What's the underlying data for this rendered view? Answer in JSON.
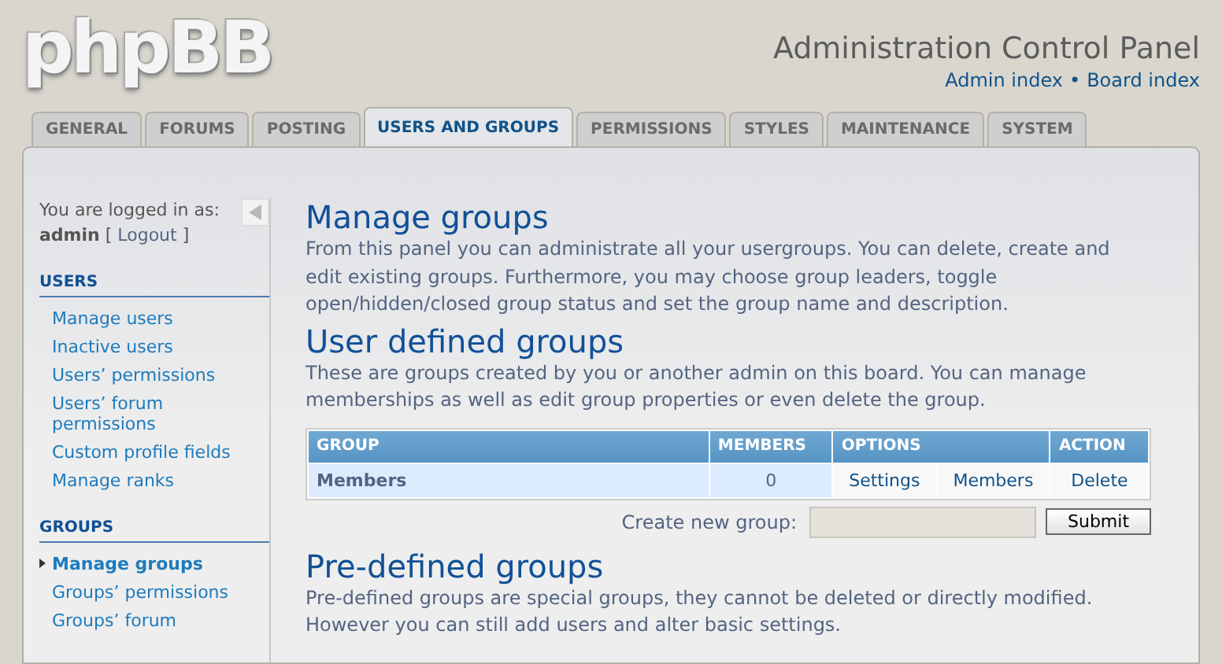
{
  "header": {
    "logo": "phpBB",
    "title": "Administration Control Panel",
    "links": [
      "Admin index",
      "Board index"
    ],
    "separator": "•"
  },
  "tabs": [
    {
      "label": "GENERAL",
      "selected": false
    },
    {
      "label": "FORUMS",
      "selected": false
    },
    {
      "label": "POSTING",
      "selected": false
    },
    {
      "label": "USERS AND GROUPS",
      "selected": true
    },
    {
      "label": "PERMISSIONS",
      "selected": false
    },
    {
      "label": "STYLES",
      "selected": false
    },
    {
      "label": "MAINTENANCE",
      "selected": false
    },
    {
      "label": "SYSTEM",
      "selected": false
    }
  ],
  "sidebar": {
    "login_text": "You are logged in as:",
    "username": "admin",
    "logout": "Logout",
    "logout_brackets": [
      "[",
      "]"
    ],
    "sections": [
      {
        "title": "USERS",
        "items": [
          {
            "label": "Manage users",
            "selected": false
          },
          {
            "label": "Inactive users",
            "selected": false
          },
          {
            "label": "Users’ permissions",
            "selected": false
          },
          {
            "label": "Users’ forum permissions",
            "selected": false
          },
          {
            "label": "Custom profile fields",
            "selected": false
          },
          {
            "label": "Manage ranks",
            "selected": false
          }
        ]
      },
      {
        "title": "GROUPS",
        "items": [
          {
            "label": "Manage groups",
            "selected": true
          },
          {
            "label": "Groups’ permissions",
            "selected": false
          },
          {
            "label": "Groups’ forum",
            "selected": false
          }
        ]
      }
    ]
  },
  "content": {
    "title": "Manage groups",
    "intro": "From this panel you can administrate all your usergroups. You can delete, create and edit existing groups. Furthermore, you may choose group leaders, toggle open/hidden/closed group status and set the group name and description.",
    "user_defined": {
      "title": "User defined groups",
      "description": "These are groups created by you or another admin on this board. You can manage memberships as well as edit group properties or even delete the group.",
      "table": {
        "columns": [
          "GROUP",
          "MEMBERS",
          "OPTIONS",
          "ACTION"
        ],
        "rows": [
          {
            "group": "Members",
            "members": "0",
            "options": [
              "Settings",
              "Members"
            ],
            "action": "Delete"
          }
        ]
      },
      "create": {
        "label": "Create new group:",
        "button": "Submit"
      }
    },
    "predefined": {
      "title": "Pre-defined groups",
      "description": "Pre-defined groups are special groups, they cannot be deleted or directly modified. However you can still add users and alter basic settings."
    }
  }
}
